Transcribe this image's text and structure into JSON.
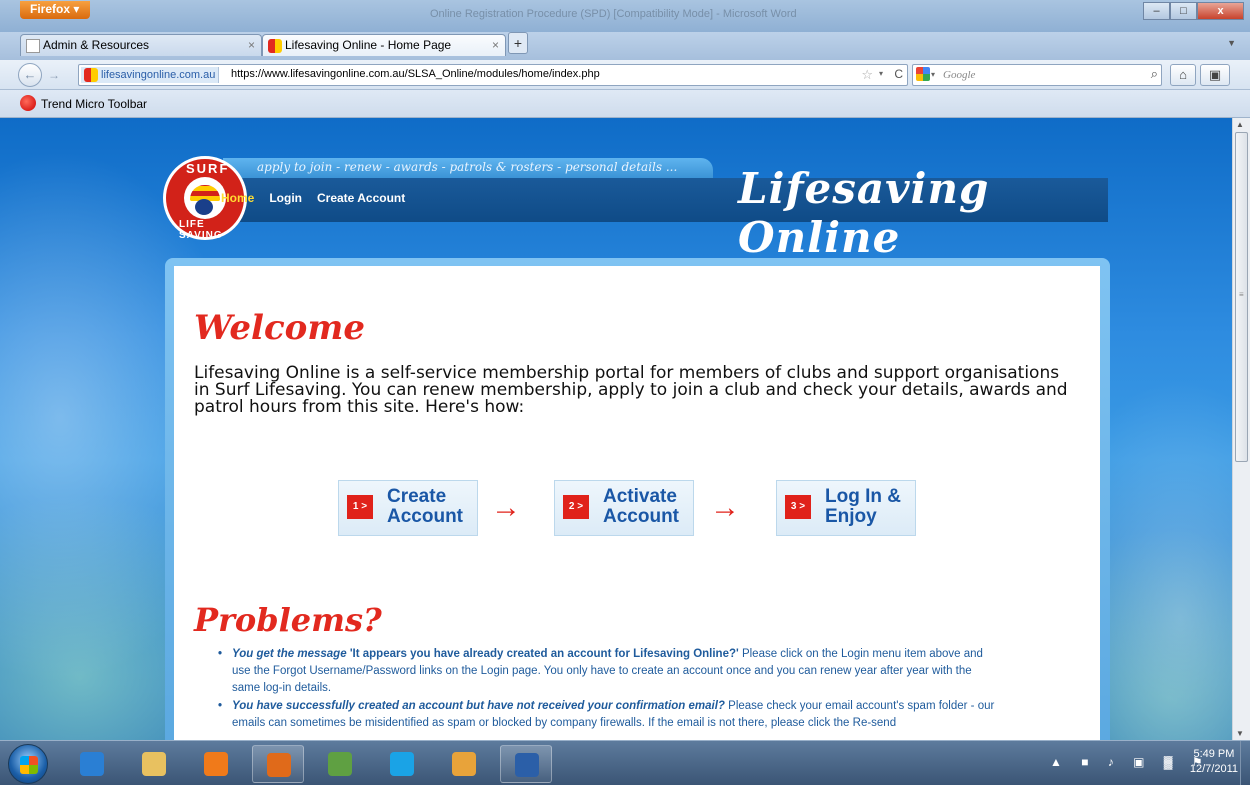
{
  "browser": {
    "menu_button": "Firefox",
    "window_title": "Online Registration Procedure (SPD) [Compatibility Mode] - Microsoft Word",
    "window_controls": {
      "minimize": "–",
      "maximize": "□",
      "close": "x"
    },
    "tabs": [
      {
        "label": "Admin & Resources",
        "close": "×",
        "active": false
      },
      {
        "label": "Lifesaving Online - Home Page",
        "close": "×",
        "active": true
      }
    ],
    "new_tab": "+",
    "tab_list_arrow": "▼",
    "nav": {
      "back": "←",
      "forward": "→",
      "identity": "lifesavingonline.com.au",
      "url": "https://www.lifesavingonline.com.au/SLSA_Online/modules/home/index.php",
      "star": "☆",
      "dropdown": "▾",
      "reload": "C",
      "search_placeholder": "Google",
      "search_dropdown": "▾",
      "search_go": "⌕",
      "home": "⌂",
      "addons": "▣"
    },
    "toolbar": {
      "trend_micro": "Trend Micro Toolbar"
    },
    "scrollbar": {
      "up": "▲",
      "down": "▼"
    }
  },
  "site": {
    "tagline": "apply to join - renew - awards - patrols & rosters - personal details ...",
    "brand": "Lifesaving Online",
    "logo_top": "SURF",
    "logo_bottom": "LIFE SAVING",
    "nav": [
      {
        "label": "Home"
      },
      {
        "label": "Login"
      },
      {
        "label": "Create Account"
      }
    ],
    "welcome_heading": "Welcome",
    "intro": "Lifesaving Online is a self-service membership portal for members of clubs and support organisations in Surf Lifesaving. You can renew membership, apply to join a club and check your details, awards and patrol hours from this site. Here's how:",
    "steps": [
      {
        "badge": "1 >",
        "label": "Create Account"
      },
      {
        "badge": "2 >",
        "label": "Activate Account"
      },
      {
        "badge": "3 >",
        "label": "Log In & Enjoy"
      }
    ],
    "step_arrow": "→",
    "problems_heading": "Problems?",
    "problems": [
      {
        "lead": "You get the message",
        "quote": "'It appears you have already created an account for Lifesaving Online?'",
        "text": " Please click on the Login menu item above and use the Forgot Username/Password links on the Login page. You only have to create an account once and you can renew year after year with the same log-in details."
      },
      {
        "lead": "You have successfully created an account but have not received your confirmation email?",
        "quote": "",
        "text": " Please check your email account's spam folder - our emails can sometimes be misidentified as spam or blocked by company firewalls. If the email is not there, please click the Re-send"
      }
    ]
  },
  "taskbar": {
    "apps": [
      {
        "name": "ie",
        "color": "#2a7fd4",
        "running": false
      },
      {
        "name": "explorer",
        "color": "#e8c160",
        "running": false
      },
      {
        "name": "media-player",
        "color": "#f07a1a",
        "running": false
      },
      {
        "name": "firefox",
        "color": "#e06a1a",
        "running": true
      },
      {
        "name": "greenhouse",
        "color": "#5fa042",
        "running": false
      },
      {
        "name": "skype",
        "color": "#1aa3e6",
        "running": false
      },
      {
        "name": "outlook",
        "color": "#e8a33a",
        "running": false
      },
      {
        "name": "word",
        "color": "#2b5fa8",
        "running": true
      }
    ],
    "tray_icons": "▲ ■ ♪ ▣ ▓ ⚑",
    "time": "5:49 PM",
    "date": "12/7/2011"
  }
}
